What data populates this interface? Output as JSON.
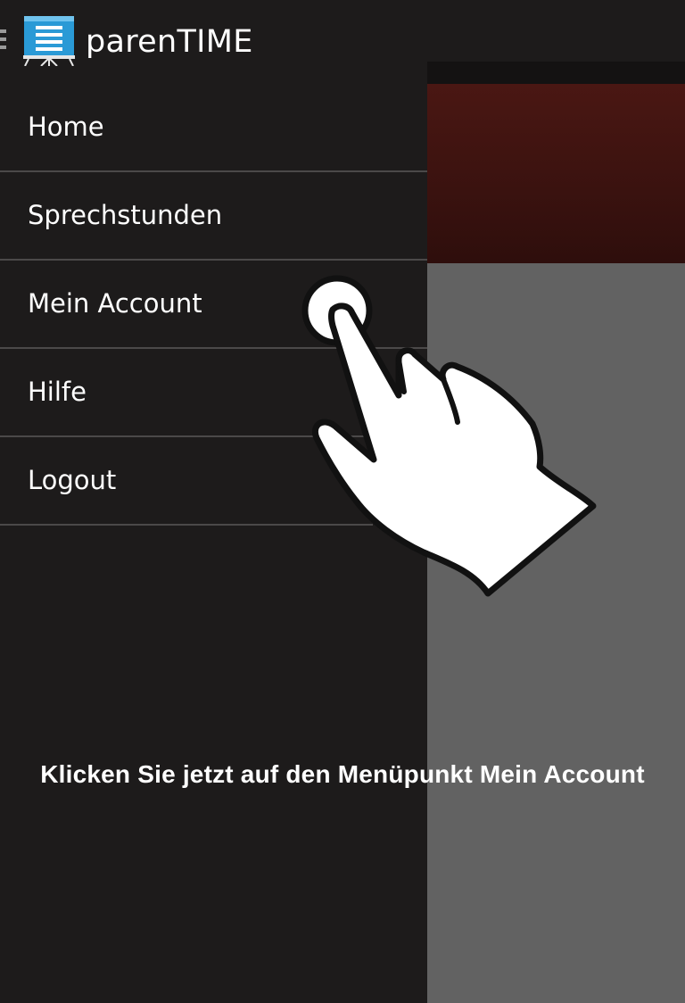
{
  "app": {
    "title": "parenTIME",
    "icon": "presentation-board-icon",
    "accent_color": "#2a9ad6"
  },
  "drawer": {
    "items": [
      {
        "label": "Home"
      },
      {
        "label": "Sprechstunden"
      },
      {
        "label": "Mein Account"
      },
      {
        "label": "Hilfe"
      },
      {
        "label": "Logout"
      }
    ]
  },
  "tutorial": {
    "instruction": "Klicken Sie jetzt auf den Menüpunkt Mein Account",
    "pointer_icon": "pointing-hand-icon",
    "target": "Mein Account"
  },
  "colors": {
    "background": "#1d1b1b",
    "content_gray": "#626262",
    "banner": "#3f130f",
    "divider": "#4b4949"
  }
}
